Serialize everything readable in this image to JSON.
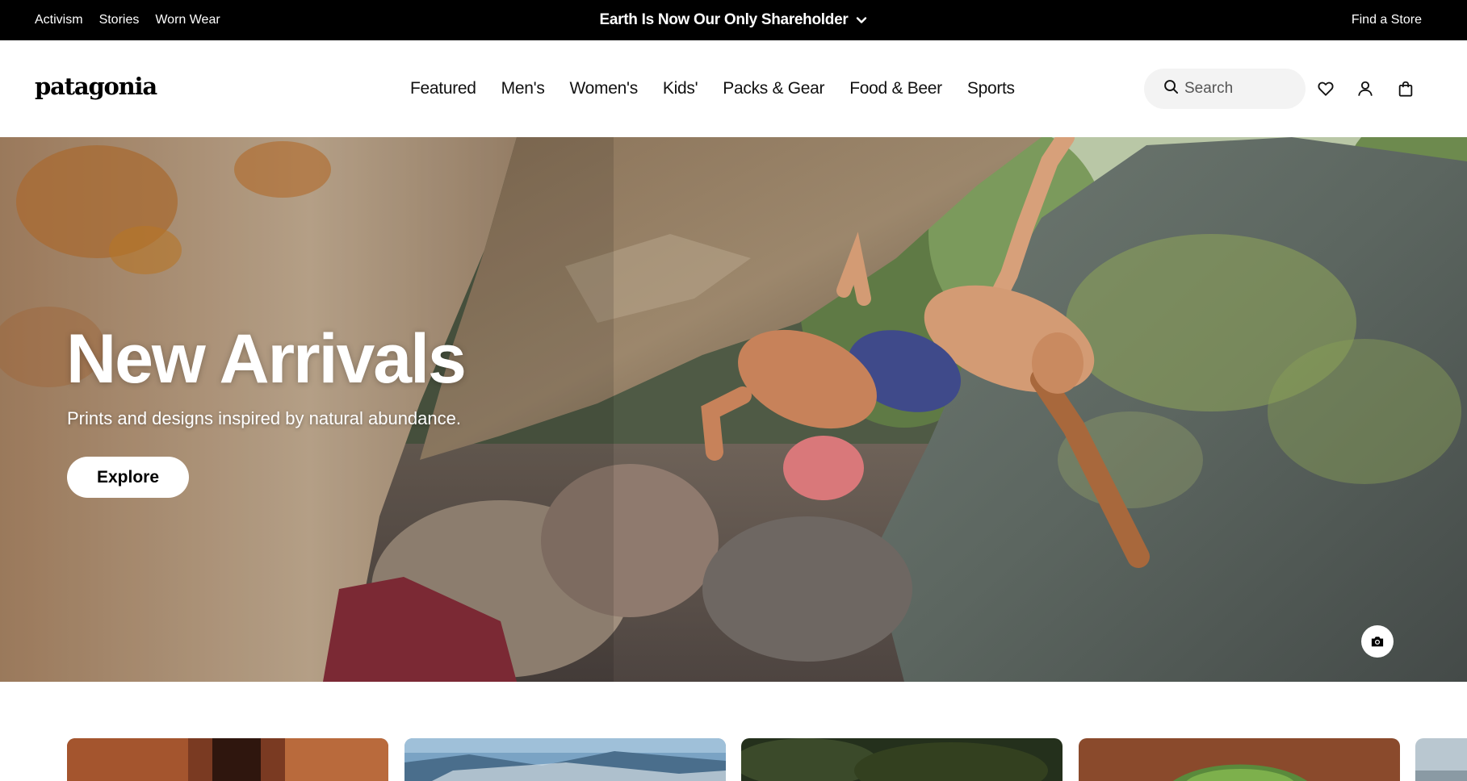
{
  "topbar": {
    "links": [
      "Activism",
      "Stories",
      "Worn Wear"
    ],
    "announcement": "Earth Is Now Our Only Shareholder",
    "find_store": "Find a Store"
  },
  "header": {
    "logo": "patagonia",
    "nav": [
      "Featured",
      "Men's",
      "Women's",
      "Kids'",
      "Packs & Gear",
      "Food & Beer",
      "Sports"
    ],
    "search_placeholder": "Search",
    "icons": [
      "search-icon",
      "heart-icon",
      "user-icon",
      "bag-icon"
    ]
  },
  "hero": {
    "title": "New Arrivals",
    "subtitle": "Prints and designs inspired by natural abundance.",
    "button": "Explore",
    "photo_credit_icon": "camera-icon"
  },
  "colors": {
    "topbar_bg": "#000000",
    "search_bg": "#f3f3f3",
    "text": "#000000"
  }
}
